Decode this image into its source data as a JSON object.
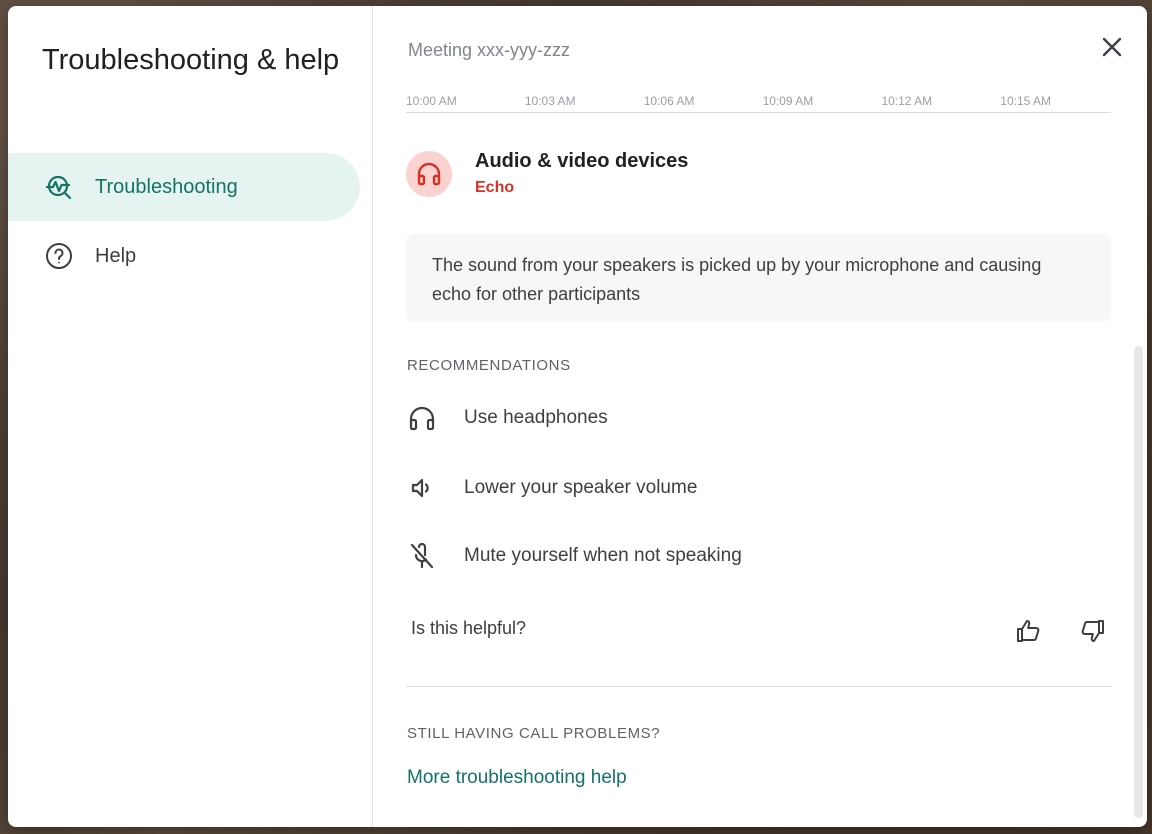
{
  "sidebar": {
    "title": "Troubleshooting & help",
    "items": [
      {
        "label": "Troubleshooting",
        "icon": "troubleshooting-icon",
        "active": true
      },
      {
        "label": "Help",
        "icon": "help-circle-icon",
        "active": false
      }
    ]
  },
  "main": {
    "meeting_title": "Meeting xxx-yyy-zzz",
    "timeline_ticks": [
      "10:00 AM",
      "10:03 AM",
      "10:06 AM",
      "10:09 AM",
      "10:12 AM",
      "10:15 AM"
    ],
    "device": {
      "title": "Audio & video devices",
      "status": "Echo",
      "icon": "headset-icon"
    },
    "explanation": "The sound from your speakers is picked up by your microphone and causing echo for other participants",
    "recommendations_header": "RECOMMENDATIONS",
    "recommendations": [
      {
        "label": "Use headphones",
        "icon": "headphones-icon"
      },
      {
        "label": "Lower your speaker volume",
        "icon": "volume-down-icon"
      },
      {
        "label": "Mute yourself when not speaking",
        "icon": "mic-off-icon"
      }
    ],
    "helpful_question": "Is this helpful?",
    "still_problems_header": "STILL HAVING CALL PROBLEMS?",
    "more_help_link": "More troubleshooting help"
  },
  "colors": {
    "accent": "#137364",
    "accent_bg": "#e6f4f1",
    "alert": "#d93025",
    "alert_bg": "#fad2cf"
  }
}
